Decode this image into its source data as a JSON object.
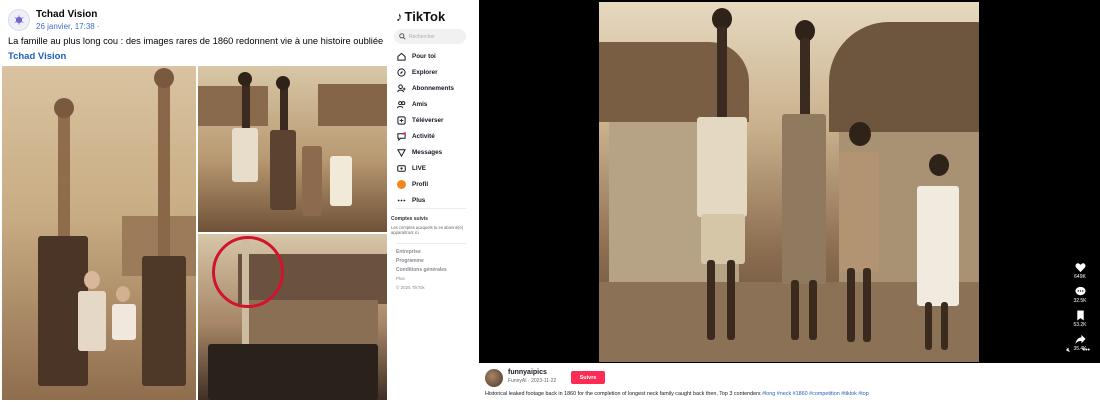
{
  "facebook": {
    "page_name": "Tchad Vision",
    "date": "26 janvier, 17:38 ·",
    "post_text": "La famille au plus long cou : des images rares de 1860 redonnent vie à une histoire oubliée",
    "link_text": "Tchad Vision"
  },
  "tiktok": {
    "logo": "TikTok",
    "search_placeholder": "Rechercher",
    "nav": [
      {
        "label": "Pour toi",
        "icon": "home-icon"
      },
      {
        "label": "Explorer",
        "icon": "compass-icon"
      },
      {
        "label": "Abonnements",
        "icon": "person-follow-icon"
      },
      {
        "label": "Amis",
        "icon": "friends-icon"
      },
      {
        "label": "Téléverser",
        "icon": "upload-icon"
      },
      {
        "label": "Activité",
        "icon": "activity-icon"
      },
      {
        "label": "Messages",
        "icon": "messages-icon"
      },
      {
        "label": "LIVE",
        "icon": "live-icon"
      },
      {
        "label": "Profil",
        "icon": "profile-icon"
      },
      {
        "label": "Plus",
        "icon": "more-icon"
      }
    ],
    "accounts": {
      "title": "Comptes suivis",
      "description": "Les comptes auxquels tu es abonné(e) apparaîtront ici"
    },
    "footer": {
      "links": [
        "Entreprise",
        "Programme",
        "Conditions générales"
      ],
      "more": "Plus",
      "copyright": "© 2025 TikTok"
    },
    "video": {
      "actions": [
        {
          "icon": "heart-icon",
          "count": "649K"
        },
        {
          "icon": "comment-icon",
          "count": "32.5K"
        },
        {
          "icon": "bookmark-icon",
          "count": "53.2K"
        },
        {
          "icon": "share-icon",
          "count": "35.4K"
        }
      ],
      "mute_icon": "mute-icon",
      "more_icon": "ellipsis-icon"
    },
    "post": {
      "username": "funnyaipics",
      "sub": "FunnyAI · 2023-11-22",
      "follow_label": "Suivre",
      "caption": "Historical leaked footage back in 1860 for the completion of longest neck family caught back then, Top 3 contenders ",
      "hashtags": "#long #neck #1860 #competition #tiktok #top"
    }
  }
}
